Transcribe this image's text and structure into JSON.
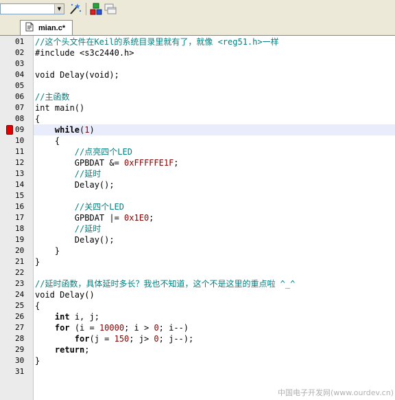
{
  "toolbar": {
    "combo_value": "",
    "icons": [
      "magic-wand-icon",
      "build-target-icon",
      "window-stack-icon"
    ]
  },
  "tab": {
    "label": "mian.c*",
    "icon": "c-file-icon"
  },
  "editor": {
    "breakpoint_line": "09",
    "highlighted_line": "09",
    "lines": [
      {
        "num": "01",
        "segments": [
          {
            "t": "//这个头文件在Keil的系统目录里就有了，就像 <reg51.h>一样",
            "c": "c"
          }
        ]
      },
      {
        "num": "02",
        "segments": [
          {
            "t": "#include <s3c2440.h>",
            "c": ""
          }
        ]
      },
      {
        "num": "03",
        "segments": []
      },
      {
        "num": "04",
        "segments": [
          {
            "t": "void Delay(void);",
            "c": ""
          }
        ]
      },
      {
        "num": "05",
        "segments": []
      },
      {
        "num": "06",
        "segments": [
          {
            "t": "//主函数",
            "c": "c"
          }
        ]
      },
      {
        "num": "07",
        "segments": [
          {
            "t": "int main()",
            "c": ""
          }
        ]
      },
      {
        "num": "08",
        "segments": [
          {
            "t": "{",
            "c": ""
          }
        ]
      },
      {
        "num": "09",
        "segments": [
          {
            "t": "    ",
            "c": ""
          },
          {
            "t": "while",
            "c": "kw"
          },
          {
            "t": "(",
            "c": ""
          },
          {
            "t": "1",
            "c": "n"
          },
          {
            "t": ")",
            "c": ""
          }
        ]
      },
      {
        "num": "10",
        "segments": [
          {
            "t": "    {",
            "c": ""
          }
        ]
      },
      {
        "num": "11",
        "segments": [
          {
            "t": "        //点亮四个LED",
            "c": "c"
          }
        ]
      },
      {
        "num": "12",
        "segments": [
          {
            "t": "        GPBDAT &= ",
            "c": ""
          },
          {
            "t": "0xFFFFFE1F",
            "c": "n"
          },
          {
            "t": ";",
            "c": ""
          }
        ]
      },
      {
        "num": "13",
        "segments": [
          {
            "t": "        //延时",
            "c": "c"
          }
        ]
      },
      {
        "num": "14",
        "segments": [
          {
            "t": "        Delay();",
            "c": ""
          }
        ]
      },
      {
        "num": "15",
        "segments": []
      },
      {
        "num": "16",
        "segments": [
          {
            "t": "        //关四个LED",
            "c": "c"
          }
        ]
      },
      {
        "num": "17",
        "segments": [
          {
            "t": "        GPBDAT |= ",
            "c": ""
          },
          {
            "t": "0x1E0",
            "c": "n"
          },
          {
            "t": ";",
            "c": ""
          }
        ]
      },
      {
        "num": "18",
        "segments": [
          {
            "t": "        //延时",
            "c": "c"
          }
        ]
      },
      {
        "num": "19",
        "segments": [
          {
            "t": "        Delay();",
            "c": ""
          }
        ]
      },
      {
        "num": "20",
        "segments": [
          {
            "t": "    }",
            "c": ""
          }
        ]
      },
      {
        "num": "21",
        "segments": [
          {
            "t": "}",
            "c": ""
          }
        ]
      },
      {
        "num": "22",
        "segments": []
      },
      {
        "num": "23",
        "segments": [
          {
            "t": "//延时函数，具体延时多长？我也不知道，这个不是这里的重点啦 ^_^",
            "c": "c"
          }
        ]
      },
      {
        "num": "24",
        "segments": [
          {
            "t": "void Delay()",
            "c": ""
          }
        ]
      },
      {
        "num": "25",
        "segments": [
          {
            "t": "{",
            "c": ""
          }
        ]
      },
      {
        "num": "26",
        "segments": [
          {
            "t": "    ",
            "c": ""
          },
          {
            "t": "int",
            "c": "kw"
          },
          {
            "t": " i, j;",
            "c": ""
          }
        ]
      },
      {
        "num": "27",
        "segments": [
          {
            "t": "    ",
            "c": ""
          },
          {
            "t": "for",
            "c": "kw"
          },
          {
            "t": " (i = ",
            "c": ""
          },
          {
            "t": "10000",
            "c": "n"
          },
          {
            "t": "; i > ",
            "c": ""
          },
          {
            "t": "0",
            "c": "n"
          },
          {
            "t": "; i--)",
            "c": ""
          }
        ]
      },
      {
        "num": "28",
        "segments": [
          {
            "t": "        ",
            "c": ""
          },
          {
            "t": "for",
            "c": "kw"
          },
          {
            "t": "(j = ",
            "c": ""
          },
          {
            "t": "150",
            "c": "n"
          },
          {
            "t": "; j> ",
            "c": ""
          },
          {
            "t": "0",
            "c": "n"
          },
          {
            "t": "; j--);",
            "c": ""
          }
        ]
      },
      {
        "num": "29",
        "segments": [
          {
            "t": "    ",
            "c": ""
          },
          {
            "t": "return",
            "c": "kw"
          },
          {
            "t": ";",
            "c": ""
          }
        ]
      },
      {
        "num": "30",
        "segments": [
          {
            "t": "}",
            "c": ""
          }
        ]
      },
      {
        "num": "31",
        "segments": []
      }
    ]
  },
  "watermark": "中国电子开发网(www.ourdev.cn)"
}
